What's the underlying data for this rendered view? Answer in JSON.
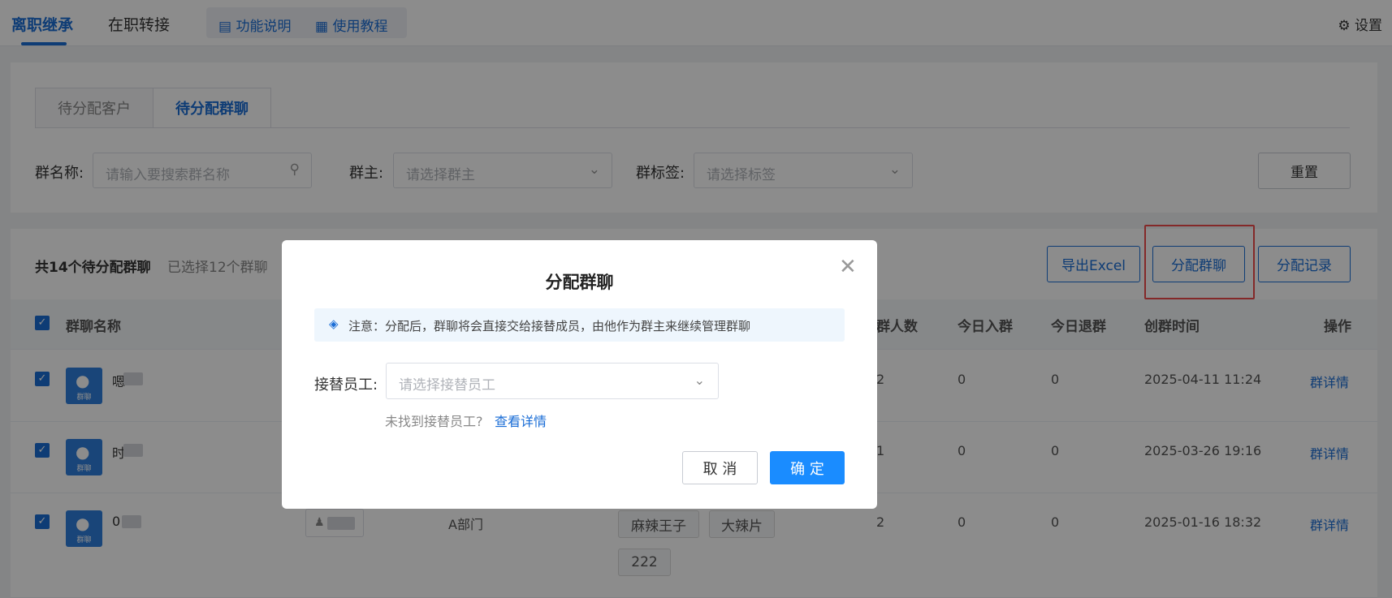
{
  "topbar": {
    "tabs": [
      {
        "label": "离职继承"
      },
      {
        "label": "在职转接"
      }
    ],
    "links": [
      {
        "label": "功能说明"
      },
      {
        "label": "使用教程"
      }
    ],
    "settings": "设置"
  },
  "filters": {
    "tabs": [
      {
        "label": "待分配客户"
      },
      {
        "label": "待分配群聊"
      }
    ],
    "name_label": "群名称:",
    "name_placeholder": "请输入要搜索群名称",
    "owner_label": "群主:",
    "owner_placeholder": "请选择群主",
    "tag_label": "群标签:",
    "tag_placeholder": "请选择标签",
    "reset": "重置"
  },
  "toolbar": {
    "total": "共14个待分配群聊",
    "selected": "已选择12个群聊",
    "export": "导出Excel",
    "assign": "分配群聊",
    "records": "分配记录"
  },
  "table": {
    "headers": {
      "name": "群聊名称",
      "members": "群人数",
      "today_join": "今日入群",
      "today_leave": "今日退群",
      "created": "创群时间",
      "actions": "操作"
    },
    "rows": [
      {
        "name_prefix": "嗯",
        "members": "2",
        "today_join": "0",
        "today_leave": "0",
        "created": "2025-04-11 11:24",
        "action": "群详情"
      },
      {
        "name_prefix": "时",
        "members": "1",
        "today_join": "0",
        "today_leave": "0",
        "created": "2025-03-26 19:16",
        "action": "群详情"
      },
      {
        "name_prefix": "0",
        "dept": "A部门",
        "tags": [
          "麻辣王子",
          "大辣片",
          "222"
        ],
        "members": "2",
        "today_join": "0",
        "today_leave": "0",
        "created": "2025-01-16 18:32",
        "action": "群详情"
      }
    ],
    "avatar_caption": "群聊"
  },
  "modal": {
    "title": "分配群聊",
    "notice": "注意：分配后，群聊将会直接交给接替成员，由他作为群主来继续管理群聊",
    "label": "接替员工:",
    "placeholder": "请选择接替员工",
    "hint": "未找到接替员工?",
    "hint_link": "查看详情",
    "cancel": "取 消",
    "ok": "确 定"
  },
  "colors": {
    "primary": "#1a6dd6",
    "button": "#1a8cff",
    "highlight": "#f04b4b"
  }
}
